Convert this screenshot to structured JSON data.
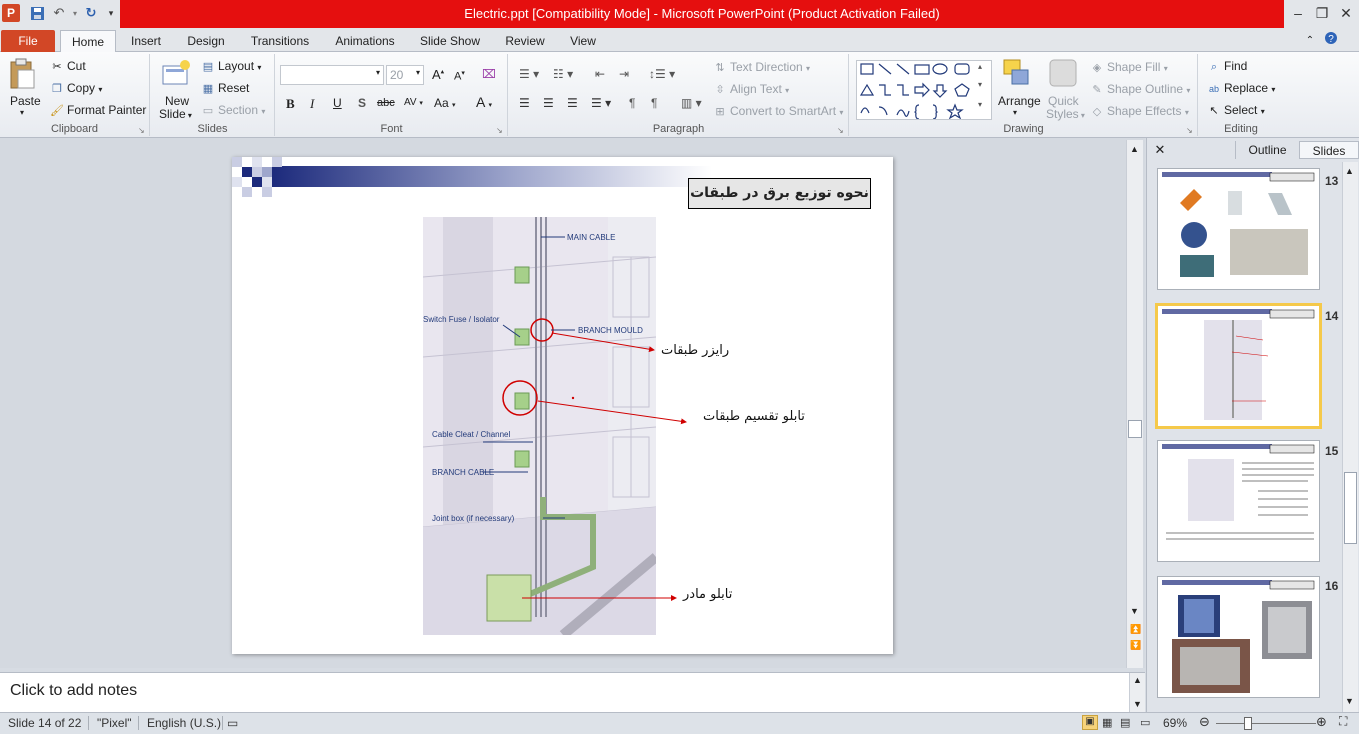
{
  "window": {
    "title": "Electric.ppt [Compatibility Mode]  -  Microsoft PowerPoint (Product Activation Failed)"
  },
  "ribbon_tabs": [
    "File",
    "Home",
    "Insert",
    "Design",
    "Transitions",
    "Animations",
    "Slide Show",
    "Review",
    "View"
  ],
  "clipboard": {
    "paste": "Paste",
    "cut": "Cut",
    "copy": "Copy",
    "format_painter": "Format Painter",
    "label": "Clipboard"
  },
  "slides_group": {
    "new_slide_1": "New",
    "new_slide_2": "Slide",
    "layout": "Layout",
    "reset": "Reset",
    "section": "Section",
    "label": "Slides"
  },
  "font_group": {
    "font_size": "20",
    "bold": "B",
    "italic": "I",
    "underline": "U",
    "shadow": "S",
    "strike": "abc",
    "spacing": "AV",
    "case": "Aa",
    "color": "A",
    "grow": "A",
    "shrink": "A",
    "label": "Font"
  },
  "paragraph_group": {
    "text_direction": "Text Direction",
    "align_text": "Align Text",
    "convert_smartart": "Convert to SmartArt",
    "label": "Paragraph"
  },
  "drawing_group": {
    "arrange": "Arrange",
    "quick_styles_1": "Quick",
    "quick_styles_2": "Styles",
    "shape_fill": "Shape Fill",
    "shape_outline": "Shape Outline",
    "shape_effects": "Shape Effects",
    "label": "Drawing"
  },
  "editing_group": {
    "find": "Find",
    "replace": "Replace",
    "select": "Select",
    "label": "Editing"
  },
  "panel": {
    "outline_tab": "Outline",
    "slides_tab": "Slides"
  },
  "thumbnails": [
    {
      "number": "13"
    },
    {
      "number": "14",
      "selected": true
    },
    {
      "number": "15"
    },
    {
      "number": "16"
    }
  ],
  "slide": {
    "title": "نحوه توزیع برق در طبقات",
    "figure_labels": {
      "main_cable": "MAIN CABLE",
      "switch_fuse": "Switch Fuse / Isolator",
      "branch_mould": "BRANCH MOULD",
      "cable_cleat": "Cable Cleat / Channel",
      "branch_cable": "BRANCH CABLE",
      "joint_box": "Joint box (if necessary)"
    },
    "annotations": {
      "riser": "رایزر طبقات",
      "floor_panel": "تابلو تقسیم طبقات",
      "main_panel": "تابلو مادر"
    }
  },
  "notes": {
    "placeholder": "Click to add notes"
  },
  "status": {
    "slide_info": "Slide 14 of 22",
    "theme": "\"Pixel\"",
    "language": "English (U.S.)",
    "zoom": "69%"
  },
  "colors": {
    "file_tab": "#d24726",
    "title_bar": "#e50f0f",
    "selected_thumb": "#f5c94a",
    "annotation_arrow": "#d00000"
  }
}
